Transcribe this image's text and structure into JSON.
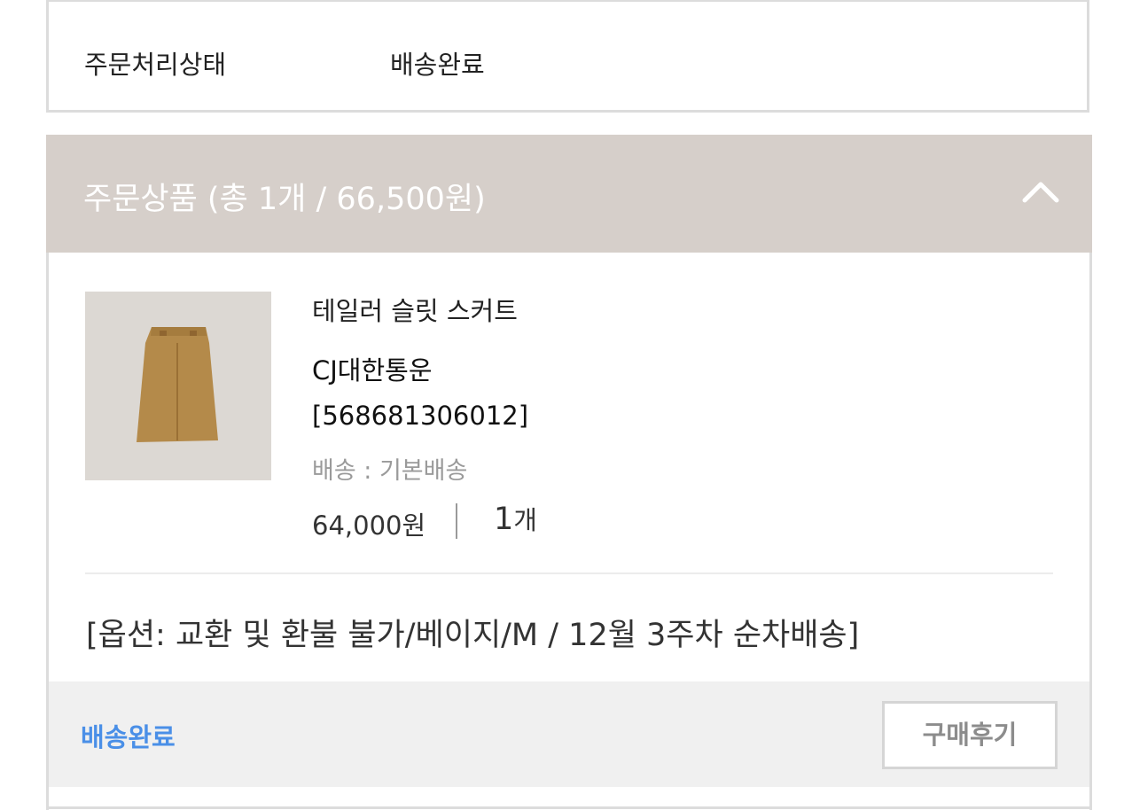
{
  "order_status": {
    "label": "주문처리상태",
    "value": "배송완료"
  },
  "products_section": {
    "title": "주문상품 (총 1개 / 66,500원)",
    "collapse_icon": "chevron-up-icon"
  },
  "product": {
    "image_icon": "skirt-thumbnail",
    "name": "테일러 슬릿 스커트",
    "carrier": "CJ대한통운",
    "tracking_number": "[568681306012]",
    "shipping": "배송 : 기본배송",
    "price": "64,000원",
    "quantity_number": "1",
    "quantity_unit": "개",
    "option": "[옵션: 교환 및 환불 불가/베이지/M / 12월 3주차 순차배송]"
  },
  "footer": {
    "status": "배송완료",
    "review_button_label": "구매후기",
    "status_color": "#4a8fe7"
  },
  "colors": {
    "header_background": "#d6cfca",
    "footer_background": "#f0f0f0"
  }
}
